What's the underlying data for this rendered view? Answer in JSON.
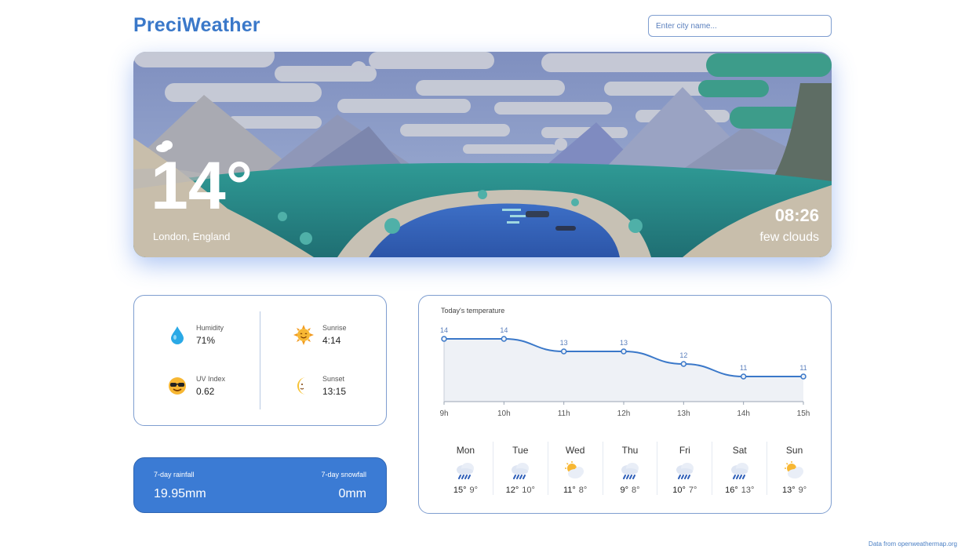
{
  "app": {
    "title": "PreciWeather"
  },
  "search": {
    "placeholder": "Enter city name..."
  },
  "hero": {
    "temperature": "14°",
    "location": "London, England",
    "time": "08:26",
    "description": "few clouds"
  },
  "stats": {
    "humidity": {
      "label": "Humidity",
      "value": "71%",
      "icon": "water-drop-icon"
    },
    "uv": {
      "label": "UV Index",
      "value": "0.62",
      "icon": "sunglasses-face-icon"
    },
    "sunrise": {
      "label": "Sunrise",
      "value": "4:14",
      "icon": "sun-face-icon"
    },
    "sunset": {
      "label": "Sunset",
      "value": "13:15",
      "icon": "moon-face-icon"
    }
  },
  "precipitation": {
    "rainfall_label": "7-day rainfall",
    "rainfall_value": "19.95mm",
    "snowfall_label": "7-day snowfall",
    "snowfall_value": "0mm"
  },
  "chart_data": {
    "type": "area",
    "title": "Today's temperature",
    "categories": [
      "9h",
      "10h",
      "11h",
      "12h",
      "13h",
      "14h",
      "15h"
    ],
    "values": [
      14,
      14,
      13,
      13,
      12,
      11,
      11
    ],
    "ylim": [
      9,
      15
    ],
    "line_color": "#3a78c9",
    "fill_color": "#eef1f6"
  },
  "week": [
    {
      "day": "Mon",
      "high": "15°",
      "low": "9°",
      "icon": "rain-cloud-icon"
    },
    {
      "day": "Tue",
      "high": "12°",
      "low": "10°",
      "icon": "rain-cloud-icon"
    },
    {
      "day": "Wed",
      "high": "11°",
      "low": "8°",
      "icon": "sun-cloud-icon"
    },
    {
      "day": "Thu",
      "high": "9°",
      "low": "8°",
      "icon": "rain-cloud-icon"
    },
    {
      "day": "Fri",
      "high": "10°",
      "low": "7°",
      "icon": "rain-cloud-icon"
    },
    {
      "day": "Sat",
      "high": "16°",
      "low": "13°",
      "icon": "rain-cloud-icon"
    },
    {
      "day": "Sun",
      "high": "13°",
      "low": "9°",
      "icon": "sun-cloud-icon"
    }
  ],
  "footer": {
    "credit": "Data from openweathermap.org"
  },
  "colors": {
    "accent": "#3a78c9",
    "rain_card": "#3b7bd4"
  }
}
